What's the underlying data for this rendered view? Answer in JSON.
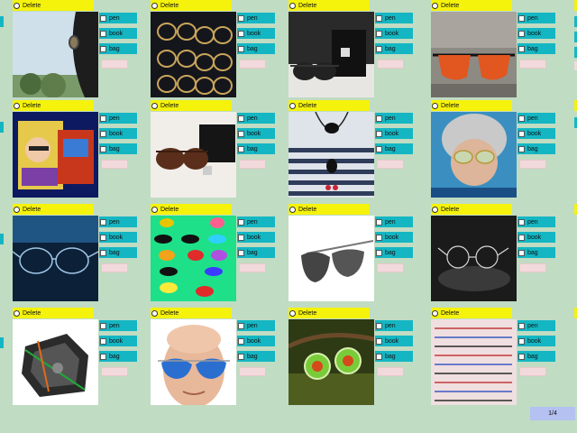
{
  "cards": [
    {
      "delete_label": "Delete",
      "tags": [
        "pen",
        "book",
        "bag"
      ]
    },
    {
      "delete_label": "Delete",
      "tags": [
        "pen",
        "book",
        "bag"
      ]
    },
    {
      "delete_label": "Delete",
      "tags": [
        "pen",
        "book",
        "bag"
      ]
    },
    {
      "delete_label": "Delete",
      "tags": [
        "pen",
        "book",
        "bag"
      ]
    },
    {
      "delete_label": "Delete",
      "tags": [
        "pen",
        "book",
        "bag"
      ]
    },
    {
      "delete_label": "Delete",
      "tags": [
        "pen",
        "book",
        "bag"
      ]
    },
    {
      "delete_label": "Delete",
      "tags": [
        "pen",
        "book",
        "bag"
      ]
    },
    {
      "delete_label": "Delete",
      "tags": [
        "pen",
        "book",
        "bag"
      ]
    },
    {
      "delete_label": "Delete",
      "tags": [
        "pen",
        "book",
        "bag"
      ]
    },
    {
      "delete_label": "Delete",
      "tags": [
        "pen",
        "book",
        "bag"
      ]
    },
    {
      "delete_label": "Delete",
      "tags": [
        "pen",
        "book",
        "bag"
      ]
    },
    {
      "delete_label": "Delete",
      "tags": [
        "pen",
        "book",
        "bag"
      ]
    },
    {
      "delete_label": "Delete",
      "tags": [
        "pen",
        "book",
        "bag"
      ]
    },
    {
      "delete_label": "Delete",
      "tags": [
        "pen",
        "book",
        "bag"
      ]
    },
    {
      "delete_label": "Delete",
      "tags": [
        "pen",
        "book",
        "bag"
      ]
    },
    {
      "delete_label": "Delete",
      "tags": [
        "pen",
        "book",
        "bag"
      ]
    }
  ],
  "pagination": {
    "label": "1/4"
  },
  "colors": {
    "background": "#c0dcc3",
    "delete_bar": "#f5f20b",
    "tag": "#14b6c3",
    "note": "#f2dadc",
    "pager": "#b4c1f1"
  }
}
